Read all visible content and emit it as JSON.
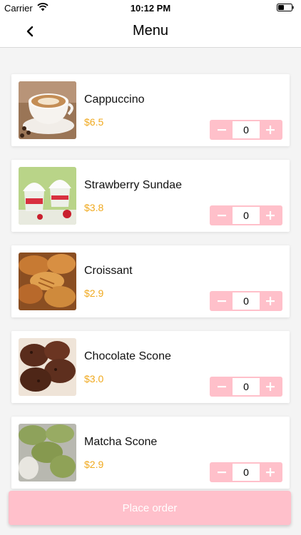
{
  "status_bar": {
    "carrier": "Carrier",
    "time": "10:12 PM",
    "wifi_icon": "wifi-icon",
    "battery_icon": "battery-icon"
  },
  "nav": {
    "title": "Menu",
    "back_icon": "chevron-left-icon"
  },
  "colors": {
    "accent_pink": "#ffc0cb",
    "price_orange": "#f0a91e",
    "background": "#f4f4f4"
  },
  "items": [
    {
      "name": "Cappuccino",
      "price": "$6.5",
      "quantity": "0",
      "minus": "−",
      "plus": "+"
    },
    {
      "name": "Strawberry Sundae",
      "price": "$3.8",
      "quantity": "0",
      "minus": "−",
      "plus": "+"
    },
    {
      "name": "Croissant",
      "price": "$2.9",
      "quantity": "0",
      "minus": "−",
      "plus": "+"
    },
    {
      "name": "Chocolate Scone",
      "price": "$3.0",
      "quantity": "0",
      "minus": "−",
      "plus": "+"
    },
    {
      "name": "Matcha Scone",
      "price": "$2.9",
      "quantity": "0",
      "minus": "−",
      "plus": "+"
    }
  ],
  "actions": {
    "place_order_label": "Place order"
  }
}
